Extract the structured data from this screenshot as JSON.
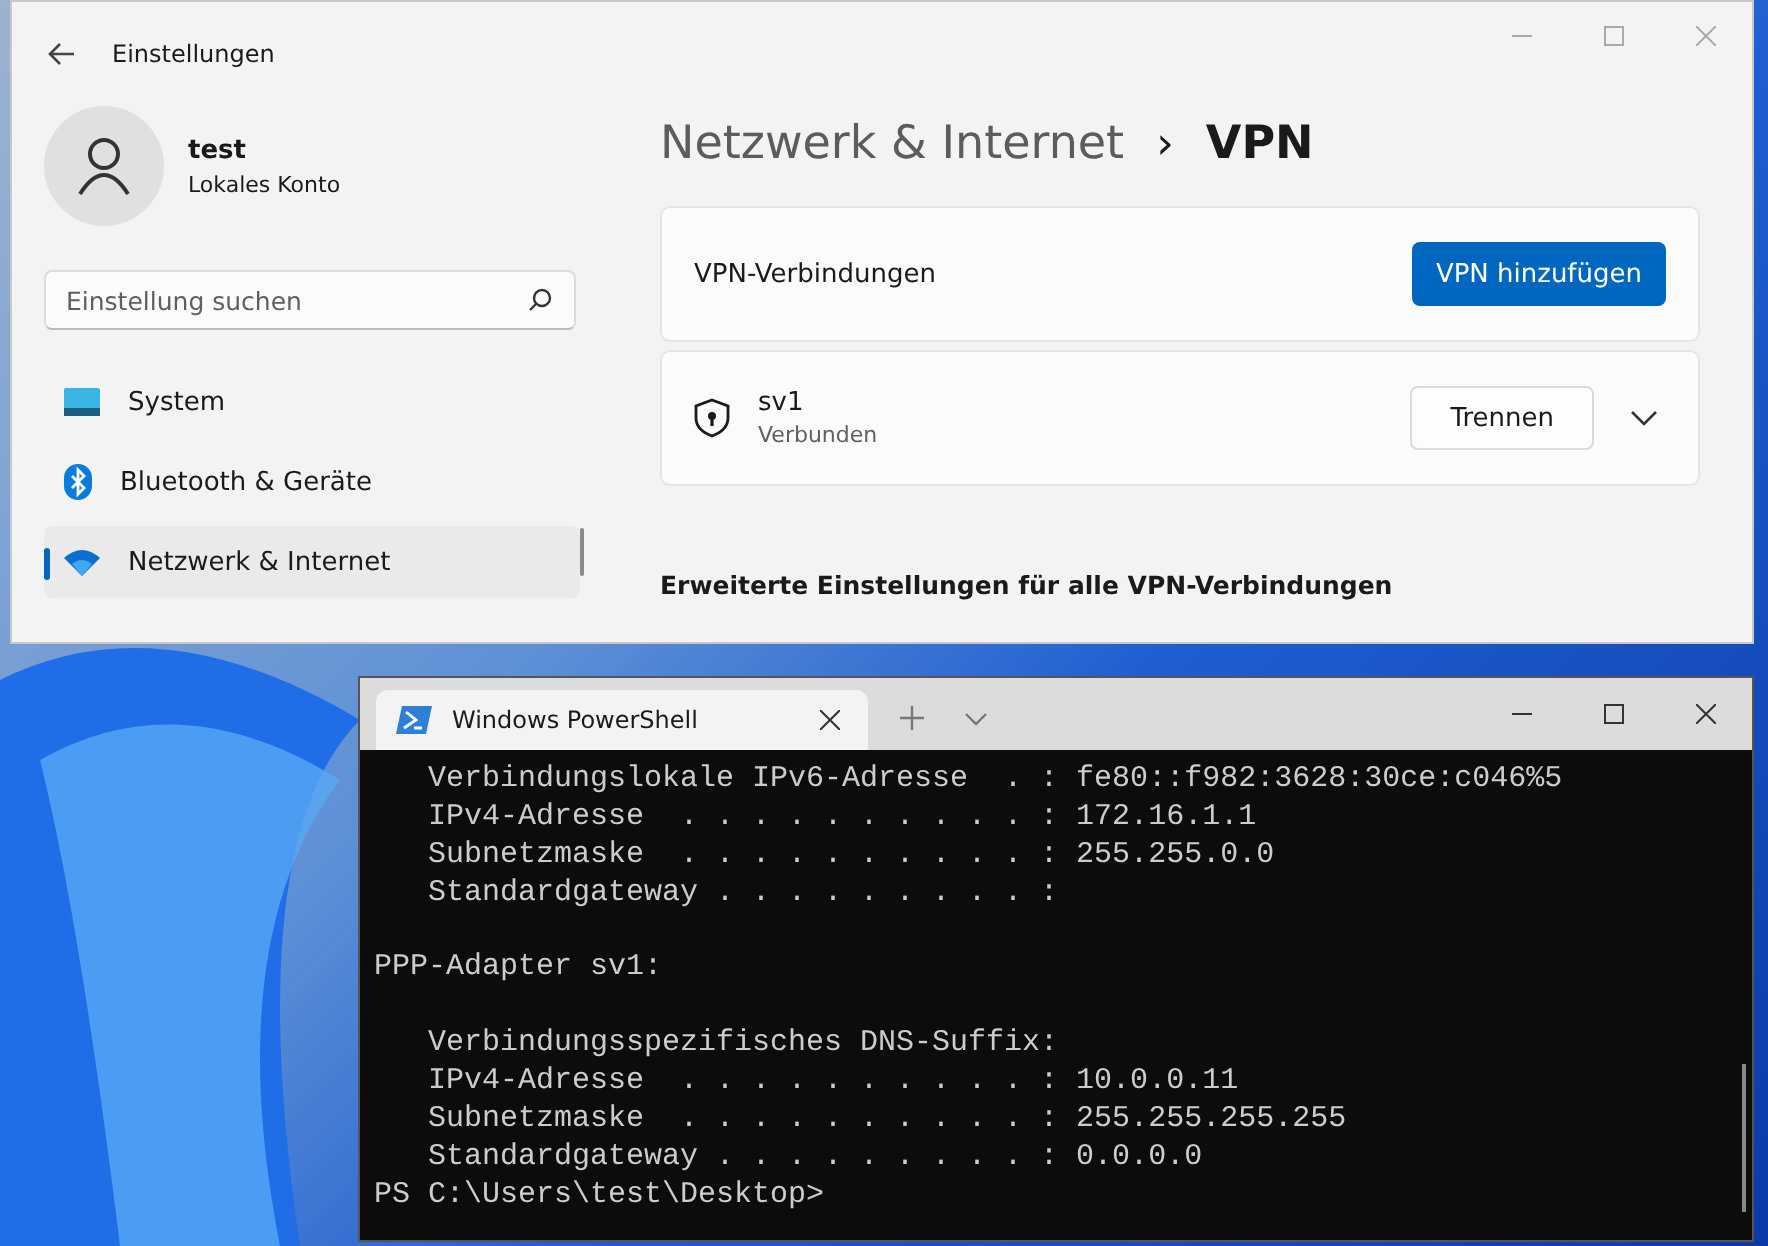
{
  "settings": {
    "title": "Einstellungen",
    "user": {
      "name": "test",
      "account": "Lokales Konto"
    },
    "search": {
      "placeholder": "Einstellung suchen"
    },
    "nav": [
      {
        "label": "System",
        "kind": "system",
        "selected": false
      },
      {
        "label": "Bluetooth & Geräte",
        "kind": "bluetooth",
        "selected": false
      },
      {
        "label": "Netzwerk & Internet",
        "kind": "network",
        "selected": true
      }
    ],
    "breadcrumb": {
      "parent": "Netzwerk & Internet",
      "separator": "›",
      "current": "VPN"
    },
    "vpn_header": {
      "label": "VPN-Verbindungen",
      "button": "VPN hinzufügen"
    },
    "connections": [
      {
        "name": "sv1",
        "status": "Verbunden",
        "button": "Trennen",
        "expanded": false
      }
    ],
    "section_heading": "Erweiterte Einstellungen für alle VPN-Verbindungen"
  },
  "terminal": {
    "tab": "Windows PowerShell",
    "lines": [
      "   Verbindungslokale IPv6-Adresse  . : fe80::f982:3628:30ce:c046%5",
      "   IPv4-Adresse  . . . . . . . . . . : 172.16.1.1",
      "   Subnetzmaske  . . . . . . . . . . : 255.255.0.0",
      "   Standardgateway . . . . . . . . . :",
      {
        "text": "PPP-Adapter sv1:",
        "blank_before": true
      },
      {
        "text": "   Verbindungsspezifisches DNS-Suffix:",
        "blank_before": true
      },
      "   IPv4-Adresse  . . . . . . . . . . : 10.0.0.11",
      "   Subnetzmaske  . . . . . . . . . . : 255.255.255.255",
      "   Standardgateway . . . . . . . . . : 0.0.0.0",
      "PS C:\\Users\\test\\Desktop>"
    ]
  }
}
